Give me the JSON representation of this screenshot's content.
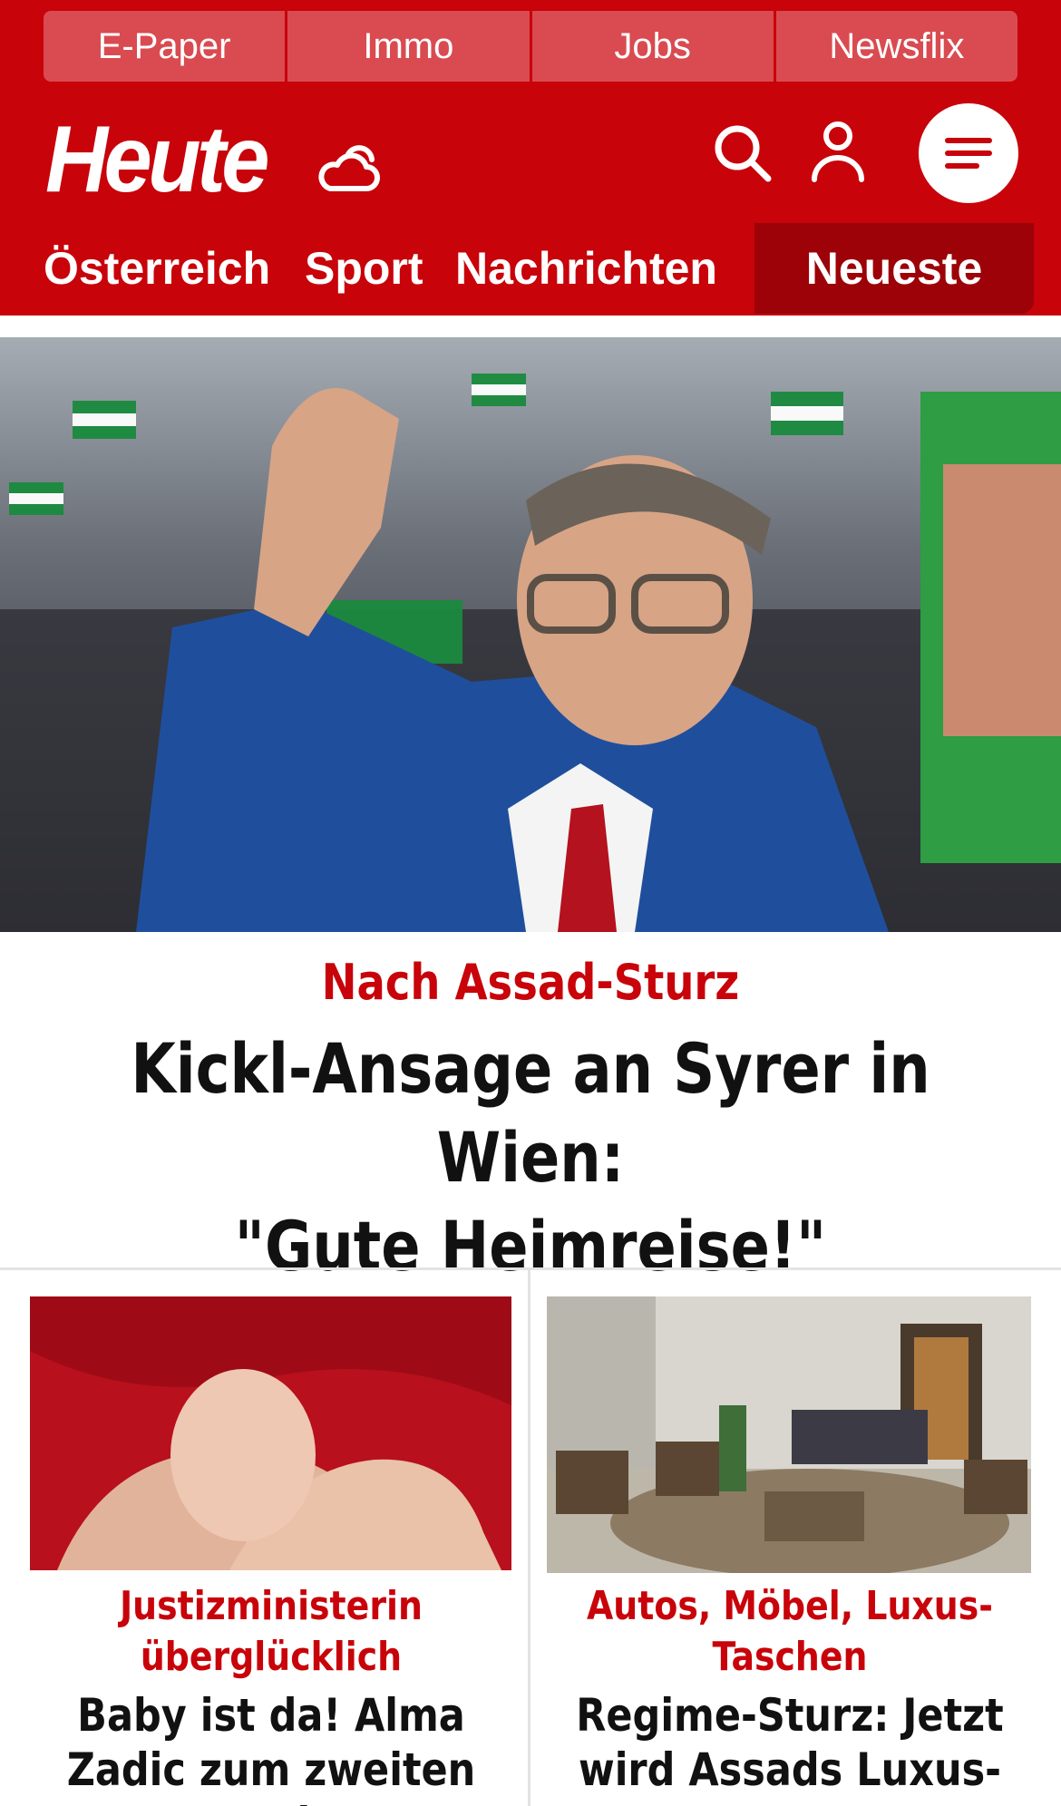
{
  "colors": {
    "brand_red": "#c8030a",
    "nav_active_red": "#9c0208",
    "quicklink_bg": "#d94b51",
    "text_dark": "#111111"
  },
  "quicklinks": [
    "E-Paper",
    "Immo",
    "Jobs",
    "Newsflix"
  ],
  "header": {
    "logo": "Heute",
    "icons": [
      "weather-cloud-sun-icon",
      "search-icon",
      "user-icon",
      "menu-icon"
    ]
  },
  "nav": {
    "items": [
      "Österreich",
      "Sport",
      "Nachrichten"
    ],
    "active": "Neueste"
  },
  "hero": {
    "kicker": "Nach Assad-Sturz",
    "title_line1": "Kickl-Ansage an Syrer in Wien:",
    "title_line2": "\"Gute Heimreise!\""
  },
  "cards": [
    {
      "kicker_line1": "Justizministerin",
      "kicker_line2": "überglücklich",
      "title_line1": "Baby ist da! Alma",
      "title_line2": "Zadic zum zweiten Mal"
    },
    {
      "kicker_line1": "Autos, Möbel, Luxus-",
      "kicker_line2": "Taschen",
      "title_line1": "Regime-Sturz: Jetzt",
      "title_line2": "wird Assads Luxus-"
    }
  ]
}
